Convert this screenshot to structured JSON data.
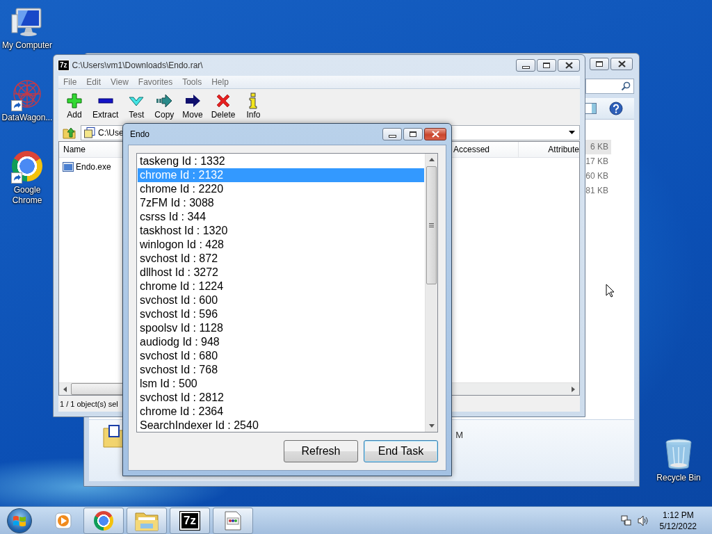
{
  "desktop_icons": [
    {
      "kind": "computer",
      "label": "My Computer",
      "shortcut": false
    },
    {
      "kind": "mesh",
      "label": "DataWagon...",
      "shortcut": true
    },
    {
      "kind": "chrome",
      "label": "Google Chrome",
      "shortcut": true
    },
    {
      "kind": "bin",
      "label": "Recycle Bin",
      "shortcut": false
    }
  ],
  "explorer_window": {
    "sizes": [
      {
        "text": "6 KB",
        "selected": true
      },
      {
        "text": "17 KB",
        "selected": false
      },
      {
        "text": "60 KB",
        "selected": false
      },
      {
        "text": "81 KB",
        "selected": false
      }
    ],
    "details_text": "M"
  },
  "archive_window": {
    "icon_text": "7z",
    "title": "C:\\Users\\vm1\\Downloads\\Endo.rar\\",
    "menu": [
      "File",
      "Edit",
      "View",
      "Favorites",
      "Tools",
      "Help"
    ],
    "toolbar": [
      {
        "kind": "add",
        "label": "Add"
      },
      {
        "kind": "extract",
        "label": "Extract"
      },
      {
        "kind": "test",
        "label": "Test"
      },
      {
        "kind": "copy",
        "label": "Copy"
      },
      {
        "kind": "move",
        "label": "Move"
      },
      {
        "kind": "delete",
        "label": "Delete"
      },
      {
        "kind": "info",
        "label": "Info"
      }
    ],
    "address": "C:\\Use",
    "columns": [
      "Name",
      "Accessed",
      "Attribute"
    ],
    "files": [
      {
        "name": "Endo.exe"
      }
    ],
    "status": "1 / 1 object(s) sel"
  },
  "dialog": {
    "title": "Endo",
    "processes": [
      {
        "label": "taskeng Id : 1332",
        "selected": false
      },
      {
        "label": "chrome Id : 2132",
        "selected": true
      },
      {
        "label": "chrome Id : 2220",
        "selected": false
      },
      {
        "label": "7zFM Id : 3088",
        "selected": false
      },
      {
        "label": "csrss Id : 344",
        "selected": false
      },
      {
        "label": "taskhost Id : 1320",
        "selected": false
      },
      {
        "label": "winlogon Id : 428",
        "selected": false
      },
      {
        "label": "svchost Id : 872",
        "selected": false
      },
      {
        "label": "dllhost Id : 3272",
        "selected": false
      },
      {
        "label": "chrome Id : 1224",
        "selected": false
      },
      {
        "label": "svchost Id : 600",
        "selected": false
      },
      {
        "label": "svchost Id : 596",
        "selected": false
      },
      {
        "label": "spoolsv Id : 1128",
        "selected": false
      },
      {
        "label": "audiodg Id : 948",
        "selected": false
      },
      {
        "label": "svchost Id : 680",
        "selected": false
      },
      {
        "label": "svchost Id : 768",
        "selected": false
      },
      {
        "label": "lsm Id : 500",
        "selected": false
      },
      {
        "label": "svchost Id : 2812",
        "selected": false
      },
      {
        "label": "chrome Id : 2364",
        "selected": false
      },
      {
        "label": "SearchIndexer Id : 2540",
        "selected": false
      }
    ],
    "buttons": [
      {
        "label": "Refresh",
        "default": false
      },
      {
        "label": "End Task",
        "default": true
      }
    ]
  },
  "taskbar": {
    "apps": [
      {
        "kind": "media",
        "running": false
      },
      {
        "kind": "chrome",
        "running": true
      },
      {
        "kind": "folder",
        "running": true
      },
      {
        "kind": "archive",
        "label": "7z",
        "running": true
      },
      {
        "kind": "app",
        "running": true
      }
    ],
    "time": "1:12 PM",
    "date": "5/12/2022"
  }
}
